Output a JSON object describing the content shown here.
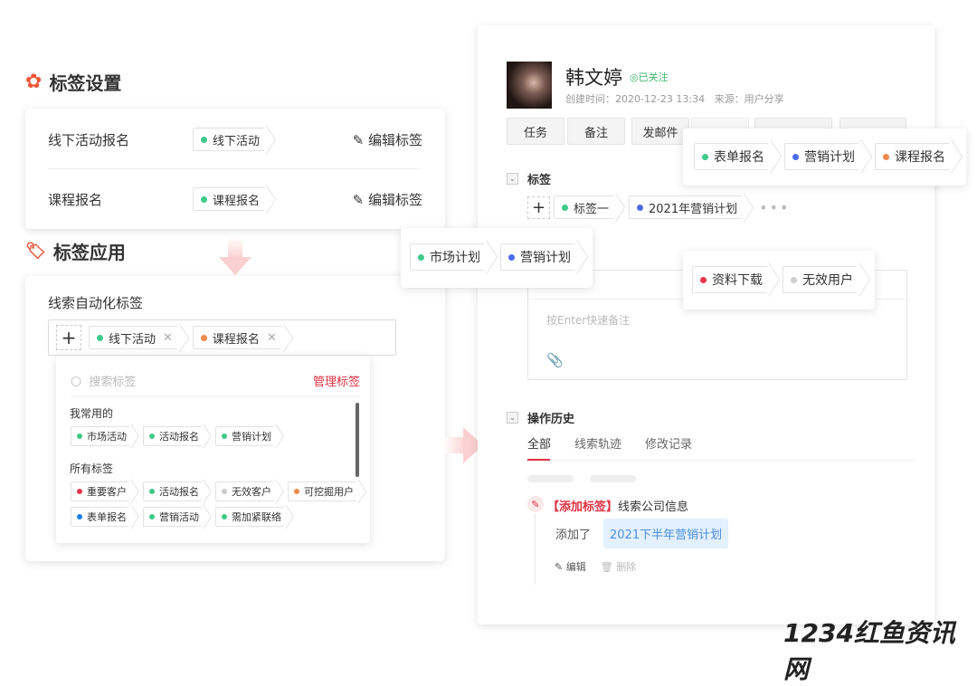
{
  "left": {
    "settings_title": "标签设置",
    "settings_rows": [
      {
        "label": "线下活动报名",
        "tag": "线下活动",
        "tag_color": "#3ec98a",
        "edit": "编辑标签"
      },
      {
        "label": "课程报名",
        "tag": "课程报名",
        "tag_color": "#3ec98a",
        "edit": "编辑标签"
      }
    ],
    "apply_title": "标签应用",
    "auto_label": "线索自动化标签",
    "selected_tags": [
      {
        "label": "线下活动",
        "color": "#3ec98a"
      },
      {
        "label": "课程报名",
        "color": "#f08a4b"
      }
    ],
    "dropdown": {
      "search_placeholder": "搜索标签",
      "manage": "管理标签",
      "frequent_title": "我常用的",
      "frequent": [
        {
          "label": "市场活动",
          "color": "#3ec98a"
        },
        {
          "label": "活动报名",
          "color": "#3ec98a"
        },
        {
          "label": "营销计划",
          "color": "#3ec98a"
        }
      ],
      "all_title": "所有标签",
      "all": [
        {
          "label": "重要客户",
          "color": "#e8344e"
        },
        {
          "label": "活动报名",
          "color": "#3ec98a"
        },
        {
          "label": "无效客户",
          "color": "#cccccc"
        },
        {
          "label": "可挖掘用户",
          "color": "#f08a4b"
        },
        {
          "label": "表单报名",
          "color": "#1a7fe8"
        },
        {
          "label": "营销活动",
          "color": "#3ec98a"
        },
        {
          "label": "需加紧联络",
          "color": "#3ec98a"
        }
      ]
    }
  },
  "profile": {
    "name": "韩文婷",
    "follow": "已关注",
    "created": "创建时间：2020-12-23 13:34",
    "source": "来源：用户分享",
    "actions": [
      "任务",
      "备注",
      "发邮件"
    ],
    "tags_title": "标签",
    "tags": [
      {
        "label": "标签一",
        "color": "#3ec98a"
      },
      {
        "label": "2021年营销计划",
        "color": "#4a6cf0"
      }
    ],
    "note_placeholder": "按Enter快速备注",
    "history_title": "操作历史",
    "tabs": [
      "全部",
      "线索轨迹",
      "修改记录"
    ],
    "entry": {
      "action": "【添加标签】",
      "subject": "线索公司信息",
      "added": "添加了",
      "value": "2021下半年营销计划",
      "edit": "编辑",
      "delete": "删除"
    }
  },
  "popovers": {
    "top": [
      {
        "label": "表单报名",
        "color": "#3ec98a"
      },
      {
        "label": "营销计划",
        "color": "#4a6cf0"
      },
      {
        "label": "课程报名",
        "color": "#f08a4b"
      }
    ],
    "middle": [
      {
        "label": "市场计划",
        "color": "#3ec98a"
      },
      {
        "label": "营销计划",
        "color": "#4a6cf0"
      }
    ],
    "bottom": [
      {
        "label": "资料下载",
        "color": "#e8344e"
      },
      {
        "label": "无效用户",
        "color": "#cccccc"
      }
    ]
  },
  "watermark": "1234红鱼资讯网",
  "colors": {
    "accent": "#e03040",
    "green": "#3ec98a",
    "link_bg": "#e3f0fd",
    "link_text": "#4a8fe0"
  }
}
